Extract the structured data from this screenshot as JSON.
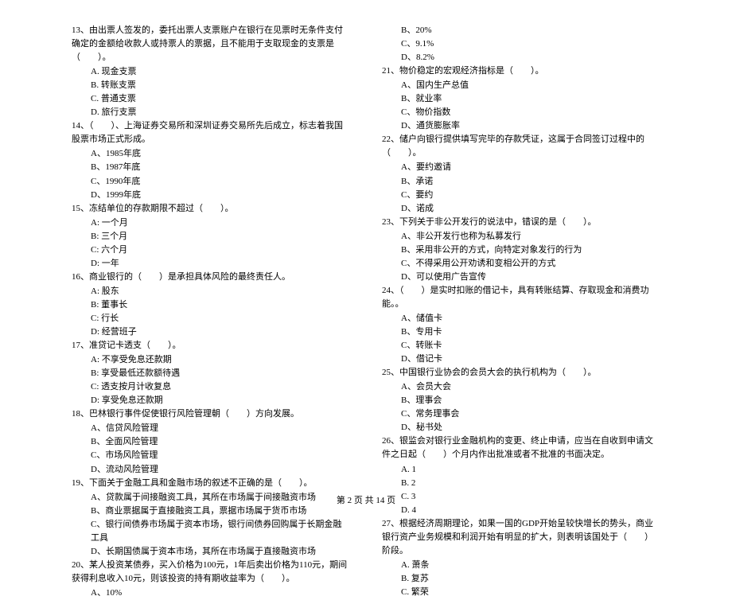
{
  "left": [
    {
      "type": "q",
      "text": "13、由出票人签发的，委托出票人支票账户在银行在见票时无条件支付确定的金额给收款人或持票人的票据，且不能用于支取现金的支票是（　　）。"
    },
    {
      "type": "opt",
      "text": "A. 现金支票"
    },
    {
      "type": "opt",
      "text": "B. 转账支票"
    },
    {
      "type": "opt",
      "text": "C. 普通支票"
    },
    {
      "type": "opt",
      "text": "D. 旅行支票"
    },
    {
      "type": "q",
      "text": "14、（　　）、上海证券交易所和深圳证券交易所先后成立，标志着我国股票市场正式形成。"
    },
    {
      "type": "opt",
      "text": "A、1985年底"
    },
    {
      "type": "opt",
      "text": "B、1987年底"
    },
    {
      "type": "opt",
      "text": "C、1990年底"
    },
    {
      "type": "opt",
      "text": "D、1999年底"
    },
    {
      "type": "q",
      "text": "15、冻结单位的存款期限不超过（　　）。"
    },
    {
      "type": "opt",
      "text": "A: 一个月"
    },
    {
      "type": "opt",
      "text": "B: 三个月"
    },
    {
      "type": "opt",
      "text": "C: 六个月"
    },
    {
      "type": "opt",
      "text": "D: 一年"
    },
    {
      "type": "q",
      "text": "16、商业银行的（　　）是承担具体风险的最终责任人。"
    },
    {
      "type": "opt",
      "text": "A: 股东"
    },
    {
      "type": "opt",
      "text": "B: 董事长"
    },
    {
      "type": "opt",
      "text": "C: 行长"
    },
    {
      "type": "opt",
      "text": "D: 经营班子"
    },
    {
      "type": "q",
      "text": "17、准贷记卡透支（　　）。"
    },
    {
      "type": "opt",
      "text": "A: 不享受免息还款期"
    },
    {
      "type": "opt",
      "text": "B: 享受最低还款额待遇"
    },
    {
      "type": "opt",
      "text": "C: 透支按月计收复息"
    },
    {
      "type": "opt",
      "text": "D: 享受免息还款期"
    },
    {
      "type": "q",
      "text": "18、巴林银行事件促使银行风险管理朝（　　）方向发展。"
    },
    {
      "type": "opt",
      "text": "A、信贷风险管理"
    },
    {
      "type": "opt",
      "text": "B、全面风险管理"
    },
    {
      "type": "opt",
      "text": "C、市场风险管理"
    },
    {
      "type": "opt",
      "text": "D、流动风险管理"
    },
    {
      "type": "q",
      "text": "19、下面关于金融工具和金融市场的叙述不正确的是（　　）。"
    },
    {
      "type": "opt",
      "text": "A、贷款属于间接融资工具，其所在市场属于间接融资市场"
    },
    {
      "type": "opt",
      "text": "B、商业票据属于直接融资工具，票据市场属于货币市场"
    },
    {
      "type": "opt",
      "text": "C、银行间债券市场属于资本市场，银行间债券回购属于长期金融工具"
    },
    {
      "type": "opt",
      "text": "D、长期国债属于资本市场，其所在市场属于直接融资市场"
    },
    {
      "type": "q",
      "text": "20、某人投资某债券，买入价格为100元，1年后卖出价格为110元，期间获得利息收入10元，则该投资的持有期收益率为（　　）。"
    },
    {
      "type": "opt",
      "text": "A、10%"
    }
  ],
  "right": [
    {
      "type": "opt",
      "text": "B、20%"
    },
    {
      "type": "opt",
      "text": "C、9.1%"
    },
    {
      "type": "opt",
      "text": "D、8.2%"
    },
    {
      "type": "q",
      "text": "21、物价稳定的宏观经济指标是（　　）。"
    },
    {
      "type": "opt",
      "text": "A、国内生产总值"
    },
    {
      "type": "opt",
      "text": "B、就业率"
    },
    {
      "type": "opt",
      "text": "C、物价指数"
    },
    {
      "type": "opt",
      "text": "D、通货膨胀率"
    },
    {
      "type": "q",
      "text": "22、储户向银行提供填写完毕的存款凭证，这属于合同签订过程中的（　　）。"
    },
    {
      "type": "opt",
      "text": "A、要约邀请"
    },
    {
      "type": "opt",
      "text": "B、承诺"
    },
    {
      "type": "opt",
      "text": "C、要约"
    },
    {
      "type": "opt",
      "text": "D、诺成"
    },
    {
      "type": "q",
      "text": "23、下列关于非公开发行的说法中，错误的是（　　）。"
    },
    {
      "type": "opt",
      "text": "A、非公开发行也称为私募发行"
    },
    {
      "type": "opt",
      "text": "B、采用非公开的方式，向特定对象发行的行为"
    },
    {
      "type": "opt",
      "text": "C、不得采用公开劝诱和变相公开的方式"
    },
    {
      "type": "opt",
      "text": "D、可以使用广告宣传"
    },
    {
      "type": "q",
      "text": "24、（　　）是实时扣账的借记卡，具有转账结算、存取现金和消费功能。。"
    },
    {
      "type": "opt",
      "text": "A、储值卡"
    },
    {
      "type": "opt",
      "text": "B、专用卡"
    },
    {
      "type": "opt",
      "text": "C、转账卡"
    },
    {
      "type": "opt",
      "text": "D、借记卡"
    },
    {
      "type": "q",
      "text": "25、中国银行业协会的会员大会的执行机构为（　　）。"
    },
    {
      "type": "opt",
      "text": "A、会员大会"
    },
    {
      "type": "opt",
      "text": "B、理事会"
    },
    {
      "type": "opt",
      "text": "C、常务理事会"
    },
    {
      "type": "opt",
      "text": "D、秘书处"
    },
    {
      "type": "q",
      "text": "26、银监会对银行业金融机构的变更、终止申请，应当在自收到申请文件之日起（　　）个月内作出批准或者不批准的书面决定。"
    },
    {
      "type": "opt",
      "text": "A. 1"
    },
    {
      "type": "opt",
      "text": "B. 2"
    },
    {
      "type": "opt",
      "text": "C. 3"
    },
    {
      "type": "opt",
      "text": "D. 4"
    },
    {
      "type": "q",
      "text": "27、根据经济周期理论，如果一国的GDP开始呈较快增长的势头，商业银行资产业务规模和利润开始有明显的扩大，则表明该国处于（　　）阶段。"
    },
    {
      "type": "opt",
      "text": "A. 萧条"
    },
    {
      "type": "opt",
      "text": "B. 复苏"
    },
    {
      "type": "opt",
      "text": "C. 繁荣"
    }
  ],
  "footer": "第 2 页 共 14 页"
}
